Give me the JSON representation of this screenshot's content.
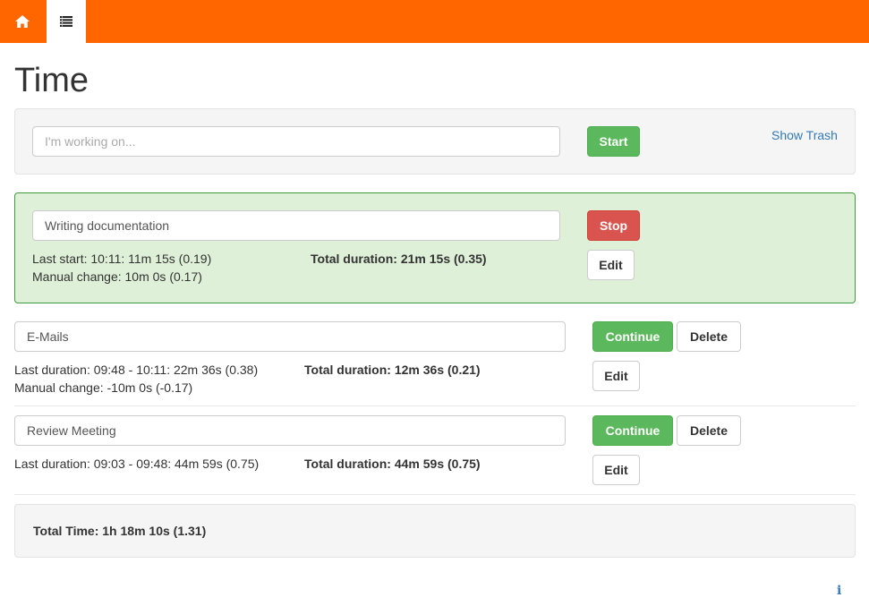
{
  "nav": {
    "home_icon": "home-icon",
    "list_icon": "list-icon",
    "brand_color": "#ff6600"
  },
  "page": {
    "title": "Time"
  },
  "new_entry": {
    "placeholder": "I'm working on...",
    "start_label": "Start",
    "show_trash_label": "Show Trash"
  },
  "active_entry": {
    "task": "Writing documentation",
    "stop_label": "Stop",
    "edit_label": "Edit",
    "last_start": "Last start: 10:11: 11m 15s (0.19)",
    "manual_change": "Manual change: 10m 0s (0.17)",
    "total_duration": "Total duration: 21m 15s (0.35)"
  },
  "entries": [
    {
      "task": "E-Mails",
      "continue_label": "Continue",
      "delete_label": "Delete",
      "edit_label": "Edit",
      "last_duration": "Last duration: 09:48 - 10:11: 22m 36s (0.38)",
      "manual_change": "Manual change: -10m 0s (-0.17)",
      "total_duration": "Total duration: 12m 36s (0.21)"
    },
    {
      "task": "Review Meeting",
      "continue_label": "Continue",
      "delete_label": "Delete",
      "edit_label": "Edit",
      "last_duration": "Last duration: 09:03 - 09:48: 44m 59s (0.75)",
      "total_duration": "Total duration: 44m 59s (0.75)"
    }
  ],
  "summary": {
    "total_time": "Total Time: 1h 18m 10s (1.31)"
  },
  "footer": {
    "info_glyph": "i"
  }
}
